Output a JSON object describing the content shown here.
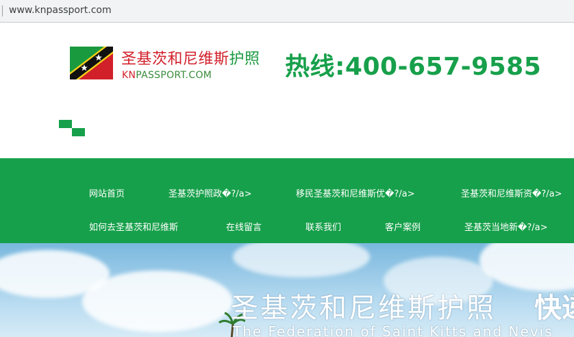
{
  "browser": {
    "url": "www.knpassport.com"
  },
  "header": {
    "logo_cn_red": "圣基茨和尼维斯",
    "logo_cn_green": "护照",
    "logo_en_red": "KN",
    "logo_en_rest": "PASSPORT.COM",
    "hotline": "热线:400-657-9585"
  },
  "nav": {
    "items": [
      {
        "label": "网站首页"
      },
      {
        "label": "圣基茨护照政�?/a>"
      },
      {
        "label": "移民圣基茨和尼维斯优�?/a>"
      },
      {
        "label": "圣基茨和尼维斯资�?/a>"
      },
      {
        "label": "如何去圣基茨和尼维斯"
      },
      {
        "label": "在线留言"
      },
      {
        "label": "联系我们"
      },
      {
        "label": "客户案例"
      },
      {
        "label": "圣基茨当地新�?/a>"
      }
    ]
  },
  "banner": {
    "title_cn": "圣基茨和尼维斯护照",
    "title_cn_cut": "快递",
    "title_en": "The Federation of Saint Kitts and Nevis"
  },
  "colors": {
    "brand_green": "#17a04b",
    "brand_red": "#d2202a"
  }
}
